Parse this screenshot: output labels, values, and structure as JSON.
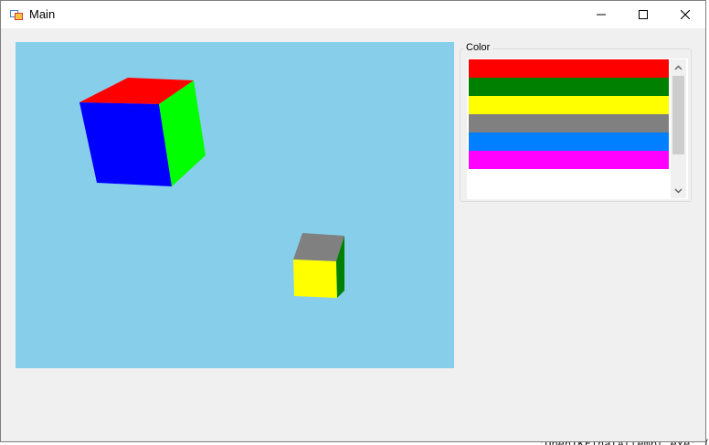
{
  "window": {
    "title": "Main",
    "controls": {
      "minimize_icon": "minimize-icon",
      "maximize_icon": "maximize-icon",
      "close_icon": "close-icon"
    }
  },
  "viewport": {
    "background": "#87ceeb",
    "objects": [
      {
        "name": "large cube",
        "faces": {
          "top": "#ff0000",
          "front": "#0000ff",
          "side": "#00ff00"
        }
      },
      {
        "name": "small cube",
        "faces": {
          "top": "#808080",
          "front": "#ffff00",
          "side": "#008000"
        }
      }
    ]
  },
  "color_panel": {
    "label": "Color",
    "colors": [
      "#ff0000",
      "#008000",
      "#ffff00",
      "#808080",
      "#0080ff",
      "#ff00ff"
    ]
  },
  "background_console": {
    "text": "'OpenTKFinalAttempt.exe' (C"
  }
}
